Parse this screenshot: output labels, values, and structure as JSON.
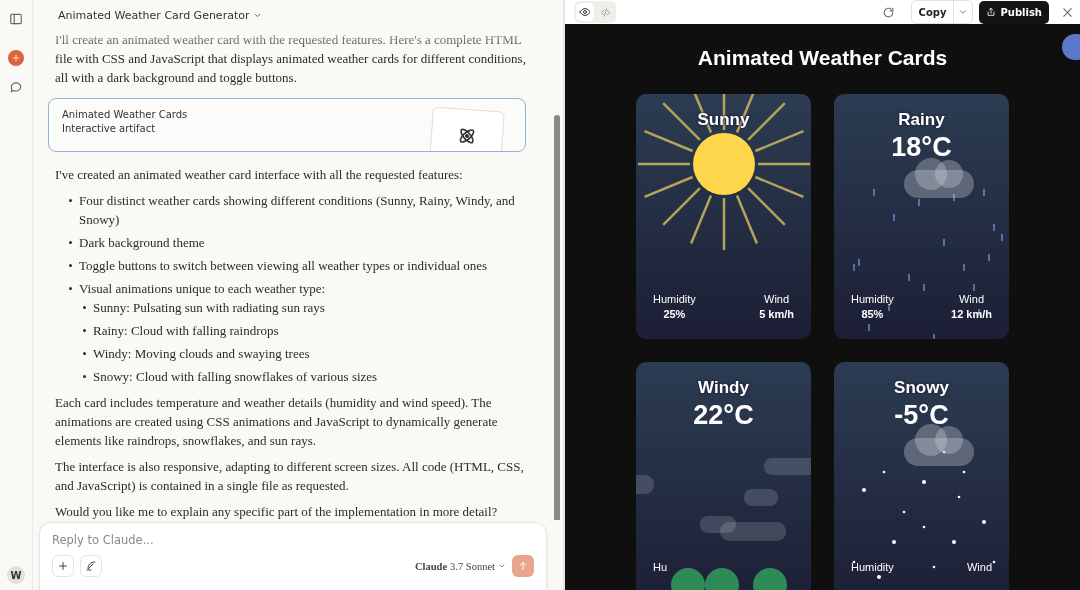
{
  "sidebar": {
    "avatar": "W"
  },
  "chat": {
    "title": "Animated Weather Card Generator",
    "intro": "I'll create an animated weather card with the requested features. Here's a complete HTML file with CSS and JavaScript that displays animated weather cards for different conditions, all with a dark background and toggle buttons.",
    "artifact": {
      "title": "Animated Weather Cards",
      "subtitle": "Interactive artifact"
    },
    "summary": "I've created an animated weather card interface with all the requested features:",
    "bullets": [
      {
        "text": "Four distinct weather cards showing different conditions (Sunny, Rainy, Windy, and Snowy)"
      },
      {
        "text": "Dark background theme"
      },
      {
        "text": "Toggle buttons to switch between viewing all weather types or individual ones"
      },
      {
        "text": "Visual animations unique to each weather type:",
        "children": [
          {
            "text": "Sunny: Pulsating sun with radiating sun rays"
          },
          {
            "text": "Rainy: Cloud with falling raindrops"
          },
          {
            "text": "Windy: Moving clouds and swaying trees"
          },
          {
            "text": "Snowy: Cloud with falling snowflakes of various sizes"
          }
        ]
      }
    ],
    "paragraphs": [
      "Each card includes temperature and weather details (humidity and wind speed). The animations are created using CSS animations and JavaScript to dynamically generate elements like raindrops, snowflakes, and sun rays.",
      "The interface is also responsive, adapting to different screen sizes. All code (HTML, CSS, and JavaScript) is contained in a single file as requested.",
      "Would you like me to explain any specific part of the implementation in more detail?"
    ],
    "composer": {
      "placeholder": "Reply to Claude...",
      "model_name": "Claude",
      "model_version": "3.7 Sonnet"
    }
  },
  "artifact_panel": {
    "view_toggle": [
      {
        "kind": "preview",
        "selected": true
      },
      {
        "kind": "code",
        "selected": false
      }
    ],
    "copy": "Copy",
    "publish": "Publish",
    "preview": {
      "heading": "Animated Weather Cards",
      "cards": [
        {
          "kind": "sunny",
          "title": "Sunny",
          "stats": [
            {
              "label": "Humidity",
              "value": "25%"
            },
            {
              "label": "Wind",
              "value": "5 km/h"
            }
          ]
        },
        {
          "kind": "rainy",
          "title": "Rainy",
          "temperature": "18°C",
          "stats": [
            {
              "label": "Humidity",
              "value": "85%"
            },
            {
              "label": "Wind",
              "value": "12 km/h"
            }
          ]
        },
        {
          "kind": "windy",
          "title": "Windy",
          "temperature": "22°C",
          "stats": [
            {
              "label": "Hu"
            }
          ]
        },
        {
          "kind": "snowy",
          "title": "Snowy",
          "temperature": "-5°C",
          "stats": [
            {
              "label": "Humidity"
            },
            {
              "label": "Wind"
            }
          ]
        }
      ]
    }
  }
}
